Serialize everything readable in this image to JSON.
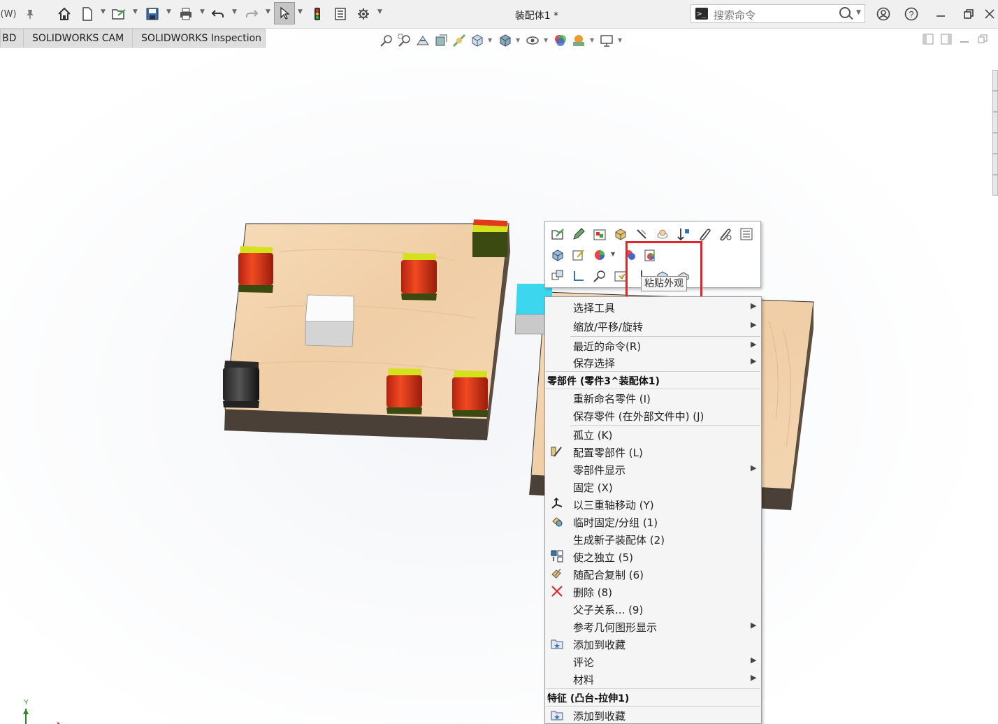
{
  "titlebar": {
    "menu_fragment": "(W)",
    "document_title": "装配体1 *",
    "search_placeholder": "搜索命令",
    "search_prompt": ">_"
  },
  "tabs": [
    {
      "label": "BD"
    },
    {
      "label": "SOLIDWORKS CAM"
    },
    {
      "label": "SOLIDWORKS Inspection"
    }
  ],
  "context_toolbar": {
    "tooltip": "粘贴外观"
  },
  "context_menu": {
    "items": [
      {
        "label": "选择工具",
        "submenu": true
      },
      {
        "label": "缩放/平移/旋转",
        "submenu": true
      },
      {
        "label": "最近的命令(R)",
        "submenu": true
      },
      {
        "label": "保存选择",
        "submenu": true
      },
      {
        "label": "零部件 (零件3^装配体1)",
        "header": true
      },
      {
        "label": "重新命名零件 (I)"
      },
      {
        "label": "保存零件 (在外部文件中) (J)"
      },
      {
        "label": "孤立 (K)"
      },
      {
        "label": "配置零部件 (L)",
        "icon": "configure-icon"
      },
      {
        "label": "零部件显示",
        "submenu": true
      },
      {
        "label": "固定 (X)"
      },
      {
        "label": "以三重轴移动 (Y)",
        "icon": "triad-icon"
      },
      {
        "label": "临时固定/分组 (1)",
        "icon": "temp-fix-icon"
      },
      {
        "label": "生成新子装配体 (2)"
      },
      {
        "label": "使之独立 (5)",
        "icon": "make-independent-icon"
      },
      {
        "label": "随配合复制 (6)",
        "icon": "copy-with-mates-icon"
      },
      {
        "label": "删除 (8)",
        "icon": "delete-icon"
      },
      {
        "label": "父子关系... (9)"
      },
      {
        "label": "参考几何图形显示",
        "submenu": true
      },
      {
        "label": "添加到收藏",
        "icon": "favorite-icon"
      },
      {
        "label": "评论",
        "submenu": true
      },
      {
        "label": "材料",
        "submenu": true
      },
      {
        "label": "特征 (凸台-拉伸1)",
        "header": true
      },
      {
        "label": "添加到收藏",
        "icon": "favorite-icon"
      }
    ]
  },
  "triad": {
    "y_label": "Y"
  },
  "colors": {
    "wood": "#f1d2ac",
    "wood_dark": "#4a4038",
    "red_block": "#d8361a",
    "lime_top": "#d4e21e",
    "highlight": "#e0262b",
    "cyan": "#3cd6ee"
  }
}
